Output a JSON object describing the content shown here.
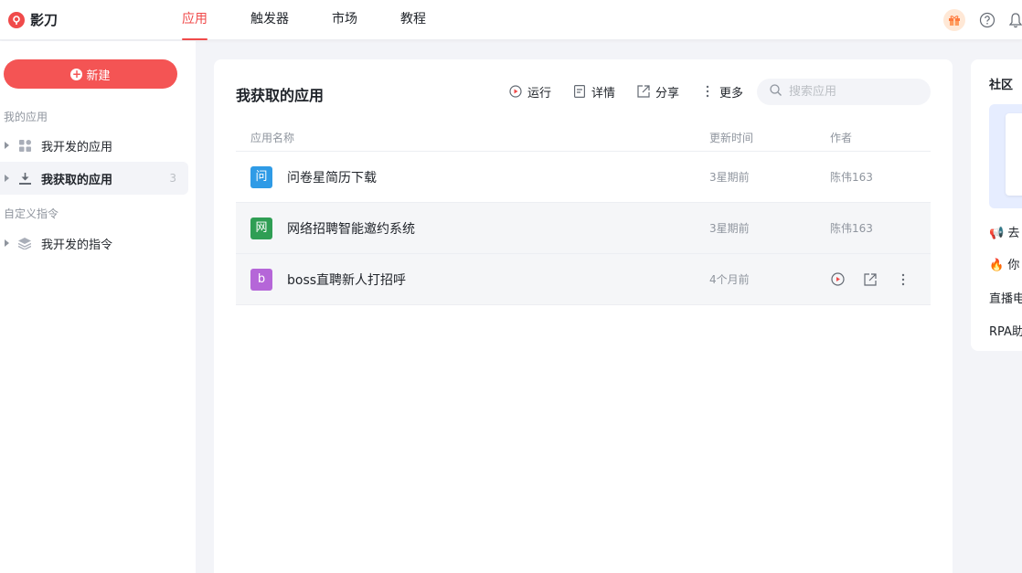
{
  "brand": {
    "name": "影刀"
  },
  "nav": {
    "items": [
      {
        "label": "应用",
        "active": true
      },
      {
        "label": "触发器",
        "active": false
      },
      {
        "label": "市场",
        "active": false
      },
      {
        "label": "教程",
        "active": false
      }
    ]
  },
  "sidebar": {
    "new_button": "新建",
    "group_my_apps": "我的应用",
    "item_developed_apps": "我开发的应用",
    "item_obtained_apps": "我获取的应用",
    "item_obtained_count": "3",
    "group_custom_commands": "自定义指令",
    "item_developed_commands": "我开发的指令"
  },
  "main": {
    "title": "我获取的应用",
    "toolbar": {
      "run": "运行",
      "details": "详情",
      "share": "分享",
      "more": "更多"
    },
    "search_placeholder": "搜索应用",
    "columns": {
      "name": "应用名称",
      "updated": "更新时间",
      "author": "作者"
    },
    "rows": [
      {
        "icon_char": "问",
        "icon_color": "#2f9be6",
        "name": "问卷星简历下载",
        "updated": "3星期前",
        "author": "陈伟163"
      },
      {
        "icon_char": "网",
        "icon_color": "#2f9e54",
        "name": "网络招聘智能邀约系统",
        "updated": "3星期前",
        "author": "陈伟163"
      },
      {
        "icon_char": "b",
        "icon_color": "#b566d8",
        "name": "boss直聘新人打招呼",
        "updated": "4个月前",
        "author": ""
      }
    ]
  },
  "community": {
    "title": "社区",
    "items": [
      "📢 去",
      "🔥 你",
      "直播电",
      "RPA助"
    ]
  },
  "colors": {
    "accent": "#f04a4a",
    "new_button": "#f45454"
  }
}
